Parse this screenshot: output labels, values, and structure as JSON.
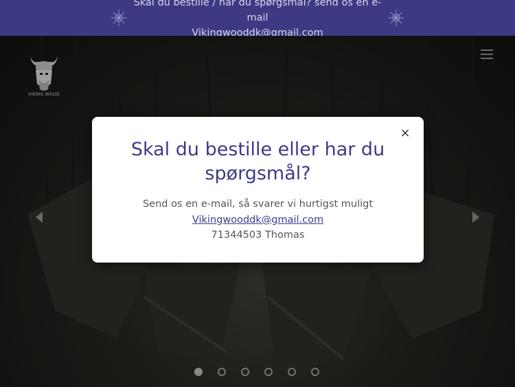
{
  "announcement": {
    "line1": "Skal du bestille / har du spørgsmål? send os en e-mail",
    "line2": "Vikingwooddk@gmail.com"
  },
  "header": {
    "logo_text": "VIKING WOOD",
    "menu_icon": "hamburger-menu-icon"
  },
  "carousel": {
    "slide_count": 6,
    "active_index": 0
  },
  "modal": {
    "title": "Skal du bestille eller har du spørgsmål?",
    "text": "Send os en e-mail, så svarer vi hurtigst muligt",
    "email": "Vikingwooddk@gmail.com",
    "phone": "71344503 Thomas",
    "close_label": "×"
  },
  "colors": {
    "accent": "#3d3a83",
    "modal_title": "#3f3a8c"
  }
}
